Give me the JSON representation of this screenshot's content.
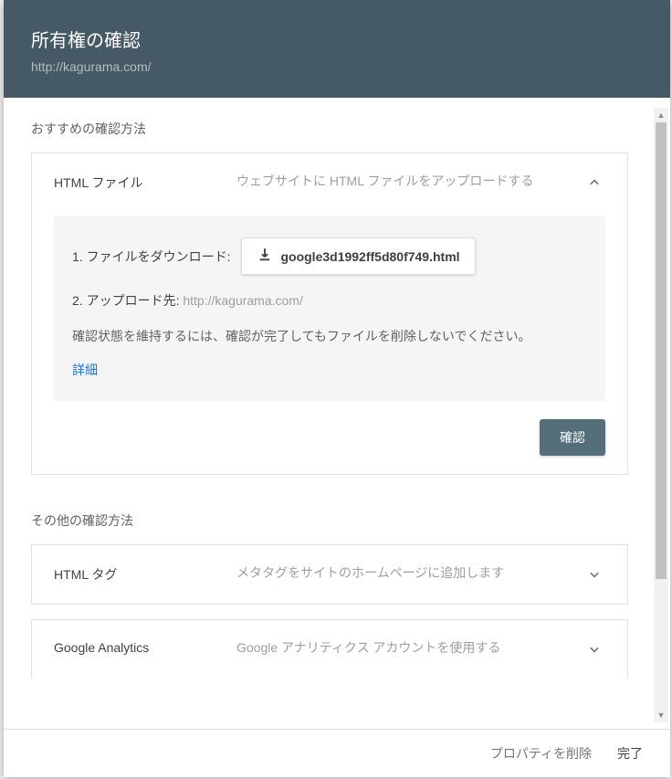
{
  "header": {
    "title": "所有権の確認",
    "url": "http://kagurama.com/"
  },
  "sections": {
    "recommended_label": "おすすめの確認方法",
    "other_label": "その他の確認方法"
  },
  "methods": {
    "html_file": {
      "name": "HTML ファイル",
      "desc": "ウェブサイトに HTML ファイルをアップロードする",
      "step1_label": "1. ファイルをダウンロード:",
      "download_filename": "google3d1992ff5d80f749.html",
      "step2_label": "2. アップロード先: ",
      "step2_url": "http://kagurama.com/",
      "note": "確認状態を維持するには、確認が完了してもファイルを削除しないでください。",
      "detail_link": "詳細",
      "verify_button": "確認"
    },
    "html_tag": {
      "name": "HTML タグ",
      "desc": "メタタグをサイトのホームページに追加します"
    },
    "ga": {
      "name": "Google Analytics",
      "desc": "Google アナリティクス アカウントを使用する"
    }
  },
  "footer": {
    "delete_property": "プロパティを削除",
    "done": "完了"
  }
}
